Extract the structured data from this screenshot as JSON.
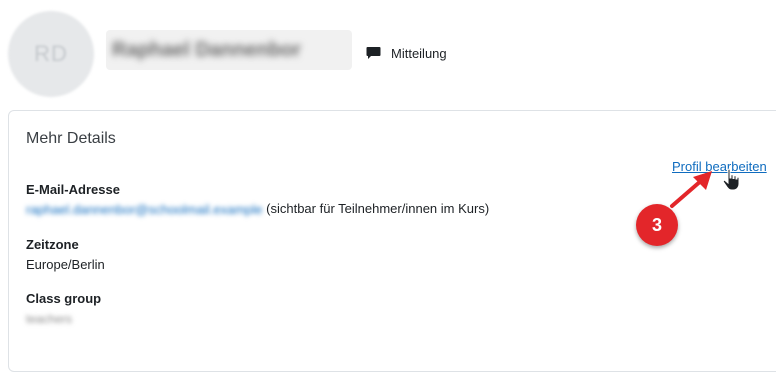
{
  "profile": {
    "avatar_initials": "RD",
    "name": "Raphael Dannenbor",
    "message_label": "Mitteilung"
  },
  "details": {
    "title": "Mehr Details",
    "edit_link": "Profil bearbeiten",
    "email_label": "E-Mail-Adresse",
    "email_value": "raphael.dannenbor@schoolmail.example",
    "email_note": "(sichtbar für Teilnehmer/innen im Kurs)",
    "timezone_label": "Zeitzone",
    "timezone_value": "Europe/Berlin",
    "classgroup_label": "Class group",
    "classgroup_value": "teachers"
  },
  "annotation": {
    "step_number": "3",
    "color": "#e3262a"
  },
  "icons": {
    "message": "message-icon",
    "cursor": "hand-cursor-icon",
    "arrow": "red-arrow-icon"
  }
}
